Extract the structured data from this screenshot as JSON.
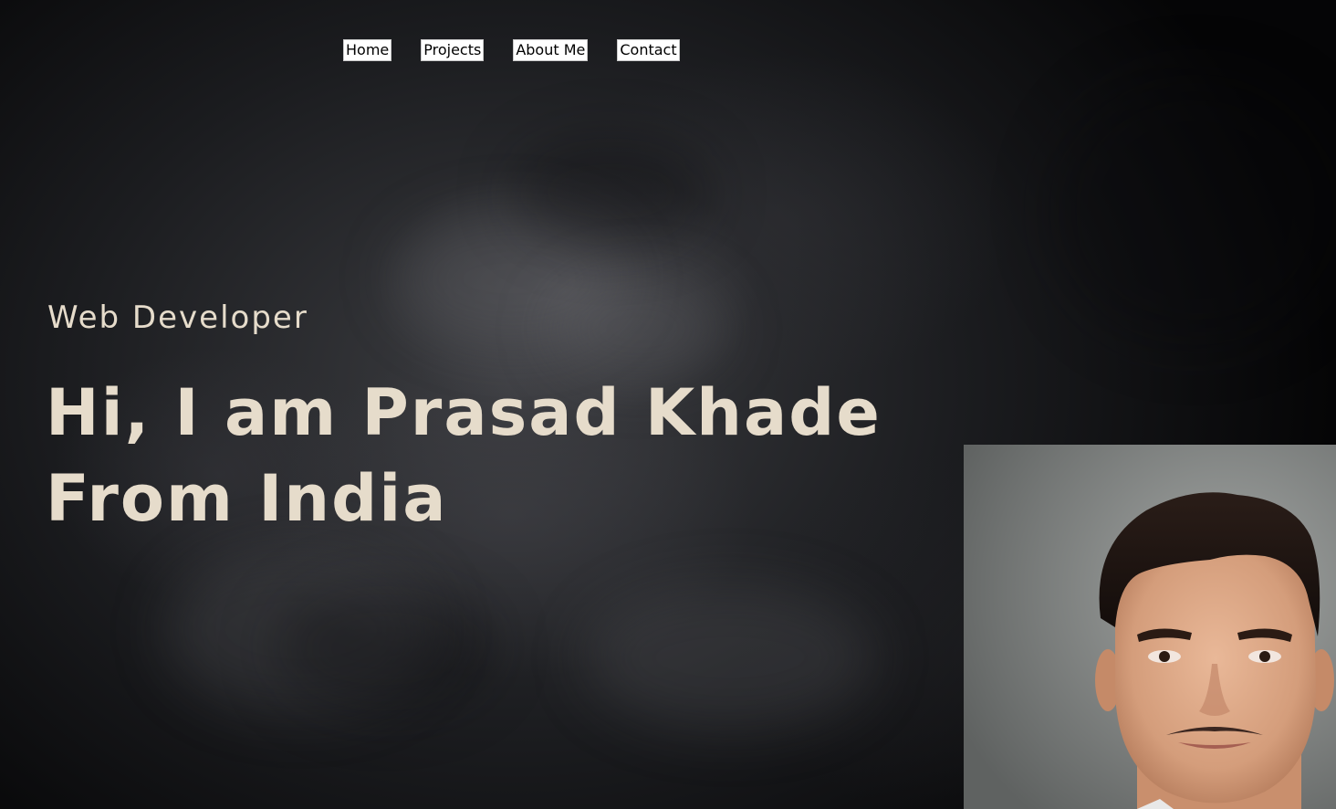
{
  "nav": {
    "items": [
      {
        "label": "Home"
      },
      {
        "label": "Projects"
      },
      {
        "label": "About Me"
      },
      {
        "label": "Contact"
      }
    ]
  },
  "hero": {
    "role": "Web Developer",
    "headline_line1": "Hi, I am Prasad Khade",
    "headline_line2": "From India"
  },
  "portrait": {
    "icon": "person-portrait-photo"
  },
  "colors": {
    "text_accent": "#e6dccb",
    "background": "#1b1c1f",
    "nav_button_bg": "#ffffff",
    "nav_button_text": "#000000"
  }
}
